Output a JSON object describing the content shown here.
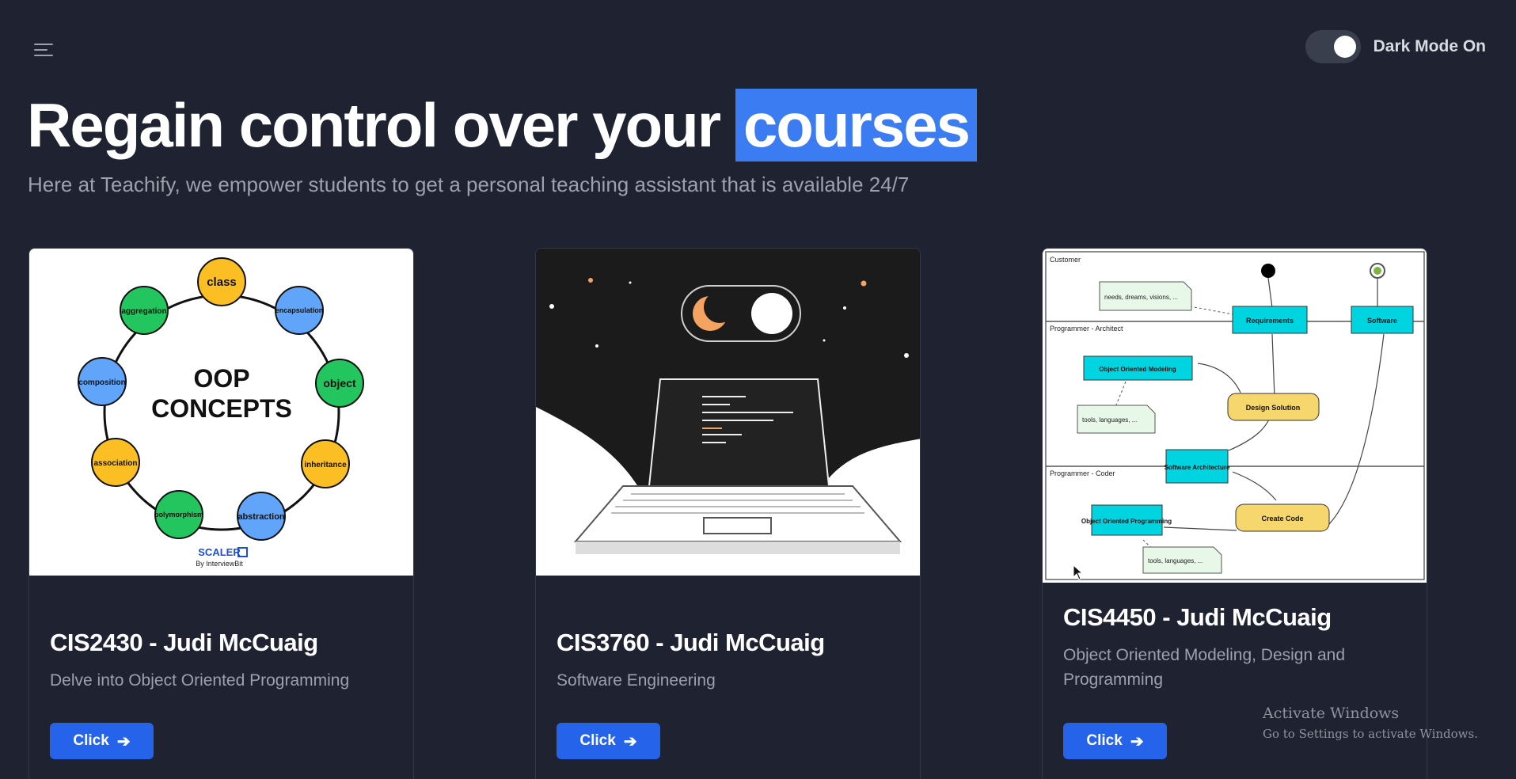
{
  "header": {
    "menu_icon": "hamburger-menu-icon",
    "dark_mode": {
      "label": "Dark Mode On",
      "on": true
    }
  },
  "hero": {
    "title_main": "Regain control over your",
    "title_highlight": "courses",
    "subtitle": "Here at Teachify, we empower students to get a personal teaching assistant that is available 24/7",
    "highlight_color": "#3b7cf2"
  },
  "courses": [
    {
      "title": "CIS2430 - Judi McCuaig",
      "description": "Delve into Object Oriented Programming",
      "button_label": "Click",
      "image": {
        "heading_line1": "OOP",
        "heading_line2": "CONCEPTS",
        "nodes": [
          "class",
          "encapsulation",
          "object",
          "inheritance",
          "abstraction",
          "polymorphism",
          "association",
          "composition",
          "aggregation"
        ],
        "brand": "SCALER",
        "brand_sub": "By InterviewBit"
      }
    },
    {
      "title": "CIS3760 - Judi McCuaig",
      "description": "Software Engineering",
      "button_label": "Click",
      "image": {
        "icon": "laptop-dark-mode-illustration"
      }
    },
    {
      "title": "CIS4450 - Judi McCuaig",
      "description": "Object Oriented Modeling, Design and Programming",
      "button_label": "Click",
      "image": {
        "lanes": [
          "Customer",
          "Programmer - Architect",
          "Programmer - Coder"
        ],
        "boxes": [
          "Requirements",
          "Software",
          "Object Oriented Modeling",
          "Design Solution",
          "Software Architecture",
          "Object Oriented Programming",
          "Create Code"
        ],
        "notes": [
          "needs, dreams, visions, ...",
          "tools, languages, ...",
          "tools, languages, ..."
        ]
      }
    }
  ],
  "button_color": "#2563eb",
  "watermark": {
    "line1": "Activate Windows",
    "line2": "Go to Settings to activate Windows."
  }
}
